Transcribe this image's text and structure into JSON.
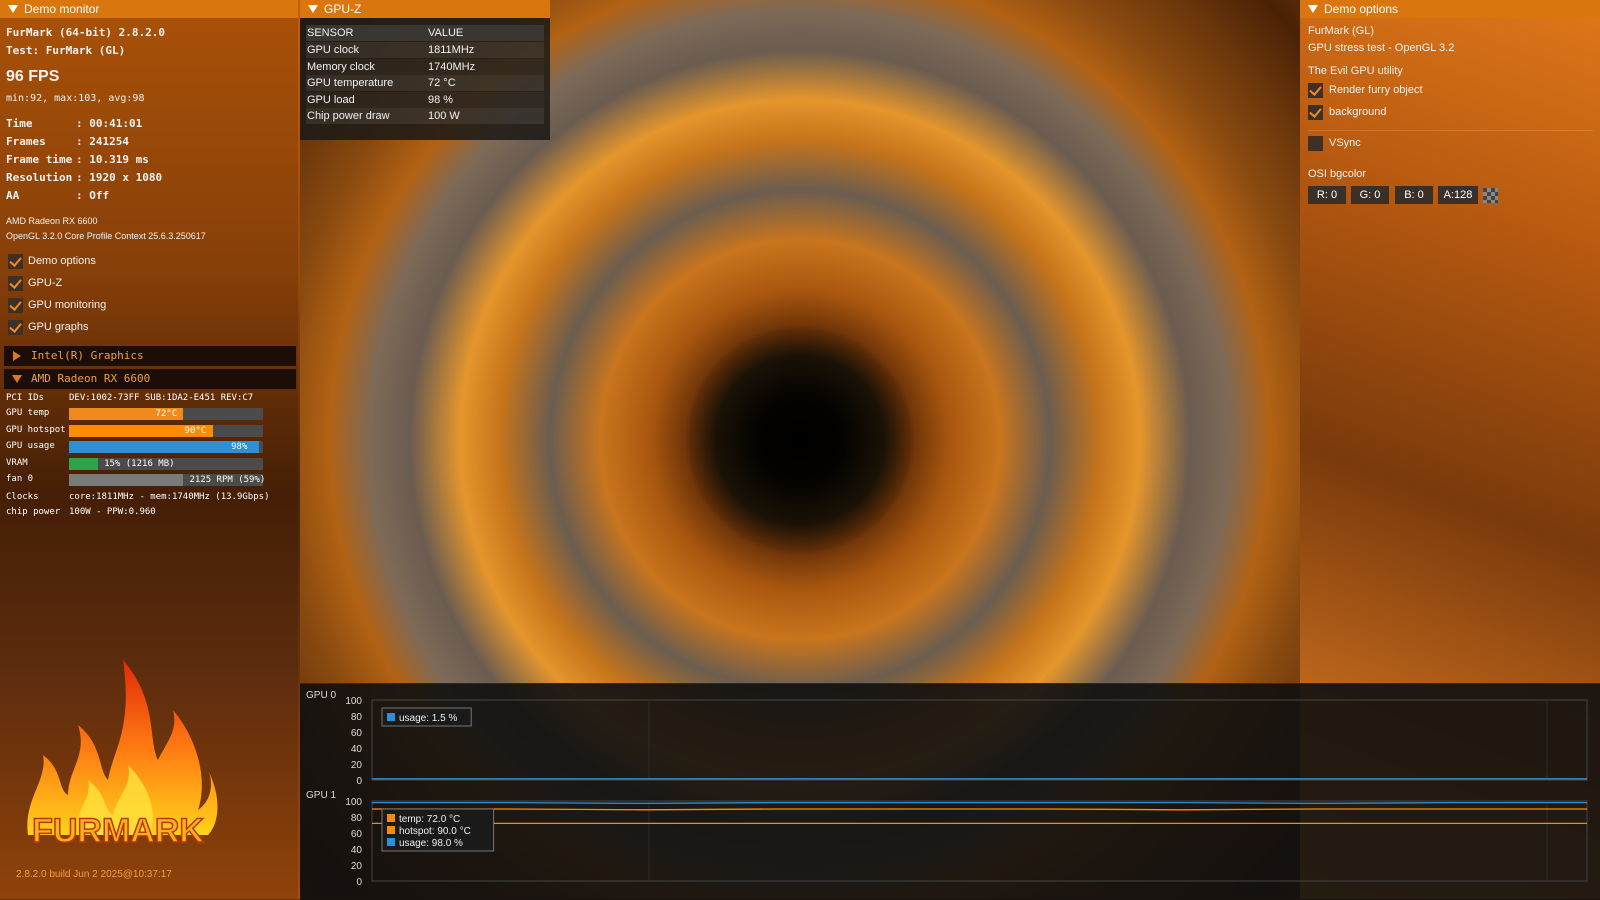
{
  "colors": {
    "accent": "#d9760d",
    "check": "#f08a1c",
    "usage_blue": "#2d8fd6",
    "temp_orange": "#f08a1c",
    "hotspot_orange": "#ff8c00",
    "vram_green": "#2fa34a",
    "fan_gray": "#7a7a7a"
  },
  "left": {
    "header": "Demo monitor",
    "app": "FurMark (64-bit) 2.8.2.0",
    "test": "Test: FurMark (GL)",
    "fps": "96 FPS",
    "fps_stats": "min:92, max:103, avg:98",
    "stats": [
      {
        "label": "Time",
        "value": ": 00:41:01"
      },
      {
        "label": "Frames",
        "value": ": 241254"
      },
      {
        "label": "Frame time",
        "value": ": 10.319 ms"
      },
      {
        "label": "Resolution",
        "value": ": 1920 x 1080"
      },
      {
        "label": "AA",
        "value": ": Off"
      }
    ],
    "gpu_name": "AMD Radeon RX 6600",
    "gl_context": "OpenGL 3.2.0 Core Profile Context 25.6.3.250617",
    "checkboxes": [
      "Demo options",
      "GPU-Z",
      "GPU monitoring",
      "GPU graphs"
    ],
    "tree": {
      "collapsed": "Intel(R) Graphics",
      "expanded": "AMD Radeon RX 6600"
    },
    "monitor": {
      "pci_label": "PCI IDs",
      "pci_value": "DEV:1002-73FF SUB:1DA2-E451 REV:C7",
      "bars": [
        {
          "label": "GPU temp",
          "text": "72°C",
          "level": 0.59,
          "color": "#f08a1c"
        },
        {
          "label": "GPU hotspot",
          "text": "90°C",
          "level": 0.74,
          "color": "#ff8c00"
        },
        {
          "label": "GPU usage",
          "text": "98%",
          "level": 0.98,
          "color": "#2d8fd6"
        },
        {
          "label": "VRAM",
          "text": "15% (1216 MB)",
          "level": 0.15,
          "color": "#2fa34a"
        },
        {
          "label": "fan 0",
          "text": "2125 RPM (59%)",
          "level": 0.59,
          "color": "#7a7a7a"
        }
      ],
      "clocks_label": "Clocks",
      "clocks_value": "core:1811MHz - mem:1740MHz (13.9Gbps)",
      "power_label": "chip power",
      "power_value": "100W - PPW:0.960"
    },
    "logo_text": "FURMARK",
    "build": "2.8.2.0 build Jun  2 2025@10:37:17"
  },
  "gpuz": {
    "header": "GPU-Z",
    "col_sensor": "SENSOR",
    "col_value": "VALUE",
    "rows": [
      {
        "sensor": "GPU clock",
        "value": "1811MHz"
      },
      {
        "sensor": "Memory clock",
        "value": "1740MHz"
      },
      {
        "sensor": "GPU temperature",
        "value": "72 °C"
      },
      {
        "sensor": "GPU load",
        "value": "98 %"
      },
      {
        "sensor": "Chip power draw",
        "value": "100 W"
      }
    ]
  },
  "right": {
    "header": "Demo options",
    "title": "FurMark (GL)",
    "subtitle": "GPU stress test - OpenGL 3.2",
    "utility": "The Evil GPU utility",
    "opt_render": "Render furry object",
    "opt_background": "background",
    "opt_vsync": "VSync",
    "osi_label": "OSI bgcolor",
    "chips": [
      "R: 0",
      "G: 0",
      "B: 0",
      "A:128"
    ]
  },
  "chart_data": [
    {
      "type": "line",
      "title": "GPU 0",
      "yticks": [
        "100",
        "80",
        "60",
        "40",
        "20",
        "0"
      ],
      "ylim": [
        0,
        100
      ],
      "series": [
        {
          "name": "usage: 1.5 %",
          "color": "#2d8fd6",
          "values": [
            1.5,
            1.5,
            1.5,
            1.5,
            1.5,
            1.5,
            1.5,
            1.5,
            1.5,
            1.5
          ]
        }
      ]
    },
    {
      "type": "line",
      "title": "GPU 1",
      "yticks": [
        "100",
        "80",
        "60",
        "40",
        "20",
        "0"
      ],
      "ylim": [
        0,
        100
      ],
      "series": [
        {
          "name": "temp: 72.0 °C",
          "color": "#f08a1c",
          "values": [
            72,
            72,
            72,
            72,
            72,
            72,
            72,
            72,
            72,
            72
          ]
        },
        {
          "name": "hotspot: 90.0 °C",
          "color": "#ff8c00",
          "values": [
            90,
            90,
            89,
            90,
            90,
            90,
            89,
            90,
            90,
            90
          ]
        },
        {
          "name": "usage: 98.0 %",
          "color": "#2d8fd6",
          "values": [
            98,
            98,
            97,
            98,
            98,
            98,
            98,
            97,
            98,
            98
          ]
        }
      ]
    }
  ]
}
